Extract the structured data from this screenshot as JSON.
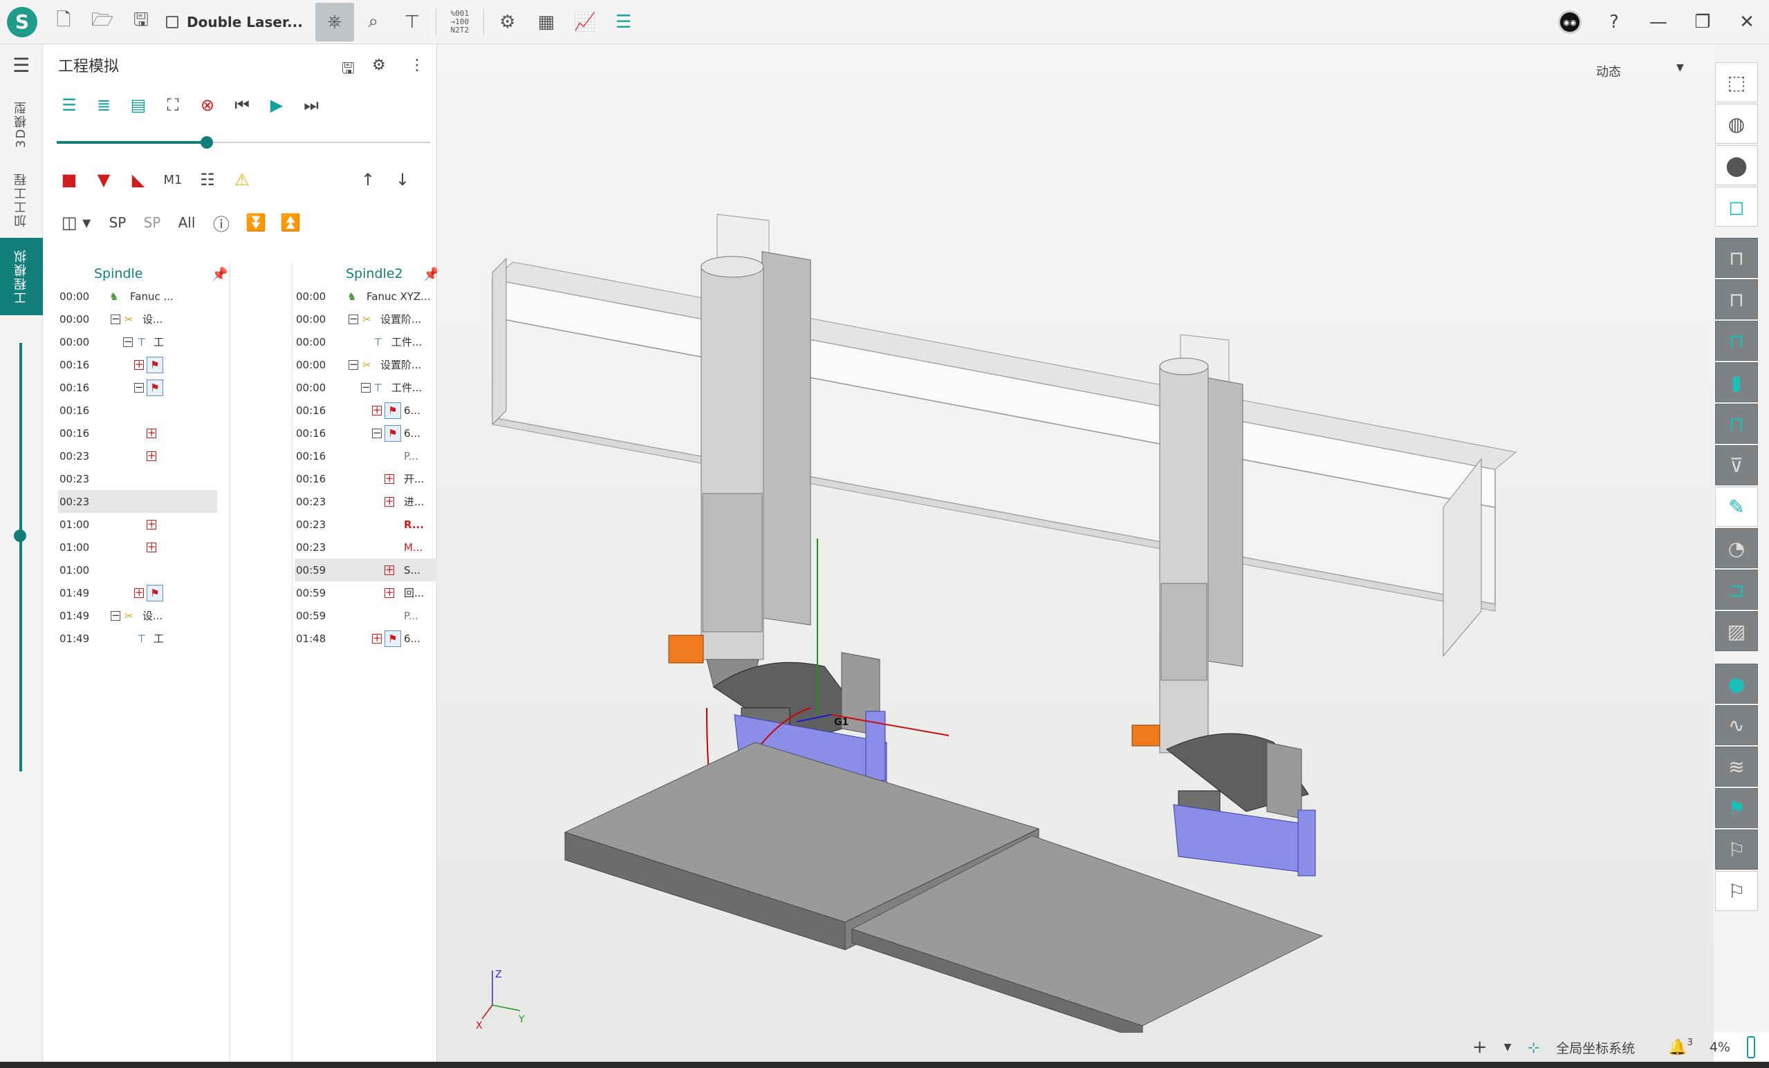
{
  "titlebar": {
    "document_title": "Double Laser...",
    "nc_icon_text": "%001\n→100\nN2T2"
  },
  "sidebar": {
    "tabs": [
      {
        "label": "3D模型"
      },
      {
        "label": "加工工程"
      },
      {
        "label": "工程模拟"
      }
    ]
  },
  "panel": {
    "title": "工程模拟",
    "filter_labels": {
      "sp_add": "SP",
      "sp_remove": "SP",
      "all": "All",
      "m1": "M1"
    },
    "columns": [
      {
        "header": "Spindle",
        "rows": [
          {
            "time": "00:00",
            "text": "Fanuc ..."
          },
          {
            "time": "00:00",
            "text": "设..."
          },
          {
            "time": "00:00",
            "text": "工"
          },
          {
            "time": "00:16",
            "text": ""
          },
          {
            "time": "00:16",
            "text": ""
          },
          {
            "time": "00:16",
            "text": ""
          },
          {
            "time": "00:16",
            "text": ""
          },
          {
            "time": "00:23",
            "text": ""
          },
          {
            "time": "00:23",
            "text": ""
          },
          {
            "time": "00:23",
            "text": ""
          },
          {
            "time": "01:00",
            "text": ""
          },
          {
            "time": "01:00",
            "text": ""
          },
          {
            "time": "01:00",
            "text": ""
          },
          {
            "time": "01:49",
            "text": ""
          },
          {
            "time": "01:49",
            "text": "设..."
          },
          {
            "time": "01:49",
            "text": "工"
          }
        ]
      },
      {
        "header": "Spindle2",
        "rows": [
          {
            "time": "00:00",
            "text": "Fanuc XYZ..."
          },
          {
            "time": "00:00",
            "text": "设置阶..."
          },
          {
            "time": "00:00",
            "text": "工件..."
          },
          {
            "time": "00:00",
            "text": "设置阶..."
          },
          {
            "time": "00:00",
            "text": "工件..."
          },
          {
            "time": "00:16",
            "text": "6..."
          },
          {
            "time": "00:16",
            "text": "6..."
          },
          {
            "time": "00:16",
            "text": "P..."
          },
          {
            "time": "00:16",
            "text": "开..."
          },
          {
            "time": "00:23",
            "text": "进..."
          },
          {
            "time": "00:23",
            "text": "R..."
          },
          {
            "time": "00:23",
            "text": "M..."
          },
          {
            "time": "00:59",
            "text": "S..."
          },
          {
            "time": "00:59",
            "text": "回..."
          },
          {
            "time": "00:59",
            "text": "P..."
          },
          {
            "time": "01:48",
            "text": "6..."
          }
        ]
      }
    ]
  },
  "viewport": {
    "view_mode": "动态",
    "axis_labels": {
      "z": "Z",
      "x": "X",
      "y": "Y"
    },
    "origin_label": "G1"
  },
  "statusbar": {
    "coord_system": "全局坐标系统",
    "notification_count": "3",
    "zoom": "4%"
  },
  "colors": {
    "accent": "#137f7a",
    "teal_icon": "#19c0b7",
    "fixture_purple": "#8a8ee8",
    "laser_orange": "#f07a1e"
  }
}
